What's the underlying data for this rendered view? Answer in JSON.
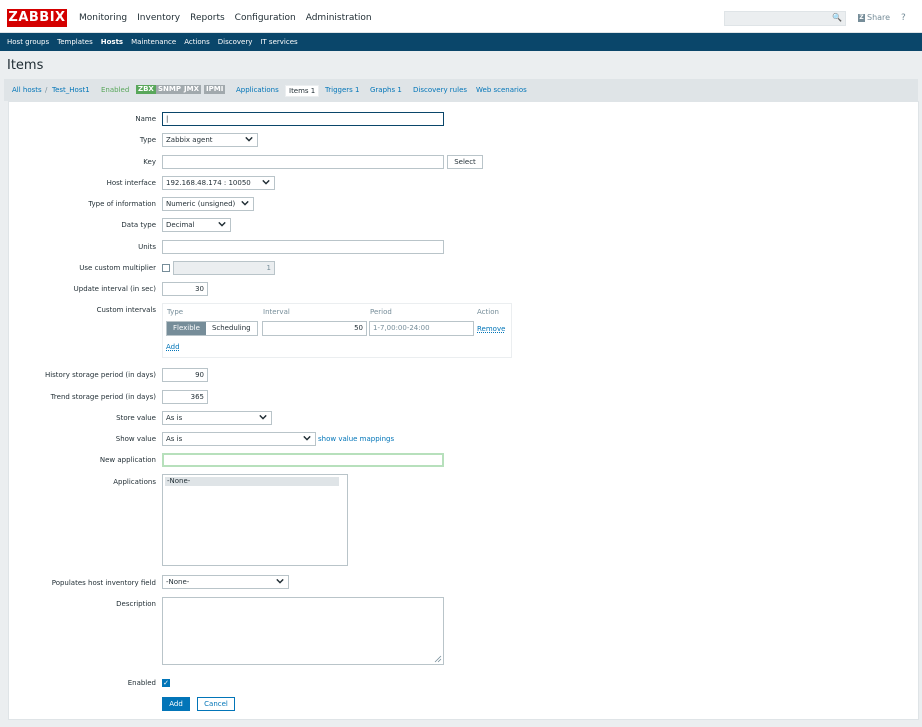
{
  "header": {
    "logo": "ZABBIX",
    "menu": [
      "Monitoring",
      "Inventory",
      "Reports",
      "Configuration",
      "Administration"
    ],
    "active_menu": "Configuration",
    "search_placeholder": "",
    "share_label": "Share",
    "help_label": "?"
  },
  "submenu": [
    "Host groups",
    "Templates",
    "Hosts",
    "Maintenance",
    "Actions",
    "Discovery",
    "IT services"
  ],
  "page_title": "Items",
  "host_nav": {
    "all_hosts": "All hosts",
    "separator": "/",
    "host": "Test_Host1",
    "status": "Enabled",
    "tags": [
      "ZBX",
      "SNMP",
      "JMX",
      "IPMI"
    ],
    "applications": "Applications",
    "items": "Items 1",
    "triggers": "Triggers 1",
    "graphs": "Graphs 1",
    "discovery": "Discovery rules",
    "web": "Web scenarios"
  },
  "form": {
    "name_label": "Name",
    "name_value": "|",
    "type_label": "Type",
    "type_value": "Zabbix agent",
    "key_label": "Key",
    "key_value": "",
    "select_label": "Select",
    "host_interface_label": "Host interface",
    "host_interface_value": "192.168.48.174 : 10050",
    "type_info_label": "Type of information",
    "type_info_value": "Numeric (unsigned)",
    "data_type_label": "Data type",
    "data_type_value": "Decimal",
    "units_label": "Units",
    "units_value": "",
    "multiplier_label": "Use custom multiplier",
    "multiplier_value": "1",
    "update_label": "Update interval (in sec)",
    "update_value": "30",
    "custom_intervals_label": "Custom intervals",
    "intervals_headers": {
      "type": "Type",
      "interval": "Interval",
      "period": "Period",
      "action": "Action"
    },
    "flexible_label": "Flexible",
    "scheduling_label": "Scheduling",
    "interval_value": "50",
    "period_value": "1-7,00:00-24:00",
    "remove_label": "Remove",
    "add_link": "Add",
    "history_label": "History storage period (in days)",
    "history_value": "90",
    "trend_label": "Trend storage period (in days)",
    "trend_value": "365",
    "store_label": "Store value",
    "store_value": "As is",
    "show_label": "Show value",
    "show_value": "As is",
    "show_mappings": "show value mappings",
    "new_app_label": "New application",
    "new_app_value": "",
    "applications_label": "Applications",
    "applications_options": [
      "-None-"
    ],
    "inventory_label": "Populates host inventory field",
    "inventory_value": "-None-",
    "description_label": "Description",
    "enabled_label": "Enabled",
    "add_button": "Add",
    "cancel_button": "Cancel"
  },
  "colors": {
    "brand": "#d40000",
    "nav": "#0a466a",
    "link": "#0275b8",
    "enabled": "#59a75b"
  }
}
